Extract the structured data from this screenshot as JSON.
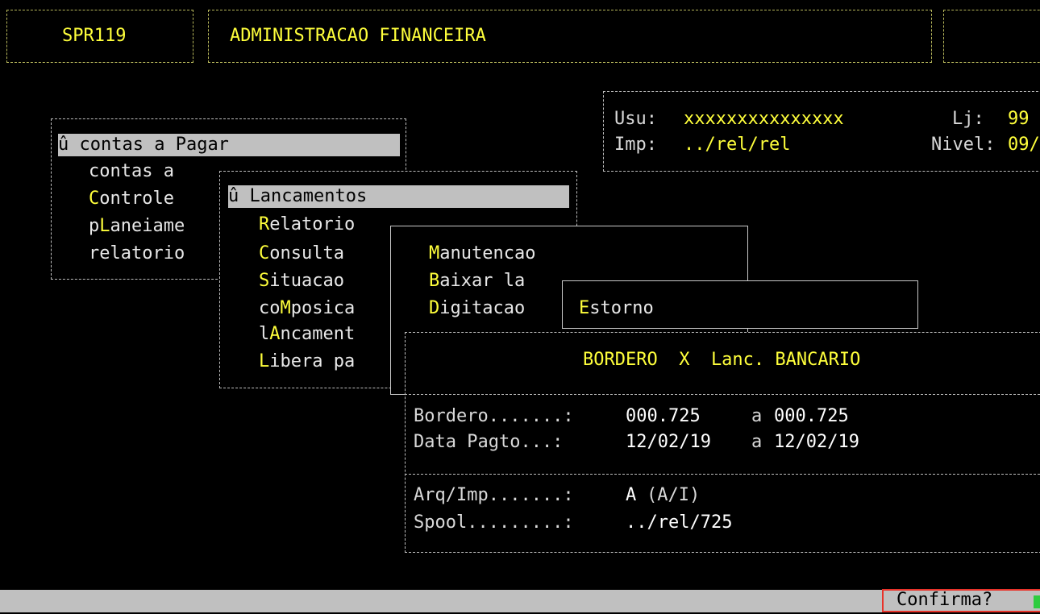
{
  "header": {
    "program_code": "SPR119",
    "module_title": "ADMINISTRACAO FINANCEIRA"
  },
  "user_info": {
    "usu_label": "Usu:",
    "usu_value": "xxxxxxxxxxxxxxx",
    "lj_label": "Lj:",
    "lj_value": "99",
    "imp_label": "Imp:",
    "imp_value": "../rel/rel",
    "nivel_label": "Nivel:",
    "nivel_value": "09/"
  },
  "menu1": {
    "marker": "û",
    "selected": "contas a Pagar",
    "items": [
      {
        "pre": "contas a",
        "key": "",
        "post": ""
      },
      {
        "pre": "",
        "key": "C",
        "post": "ontrole"
      },
      {
        "pre": "p",
        "key": "L",
        "post": "aneiame"
      },
      {
        "pre": "relatorio",
        "key": "",
        "post": ""
      }
    ]
  },
  "menu2": {
    "marker": "û",
    "selected": "Lancamentos",
    "items": [
      {
        "pre": "",
        "key": "R",
        "post": "elatorio"
      },
      {
        "pre": "",
        "key": "C",
        "post": "onsulta"
      },
      {
        "pre": "",
        "key": "S",
        "post": "ituacao"
      },
      {
        "pre": "co",
        "key": "M",
        "post": "posica"
      },
      {
        "pre": "l",
        "key": "A",
        "post": "ncament"
      },
      {
        "pre": "",
        "key": "L",
        "post": "ibera pa"
      }
    ]
  },
  "menu3": {
    "items": [
      {
        "pre": "",
        "key": "M",
        "post": "anutencao"
      },
      {
        "pre": "",
        "key": "B",
        "post": "aixar la"
      },
      {
        "pre": "",
        "key": "D",
        "post": "igitacao"
      }
    ]
  },
  "menu4": {
    "items": [
      {
        "pre": "",
        "key": "E",
        "post": "storno"
      }
    ]
  },
  "dialog": {
    "title": "BORDERO  X  Lanc. BANCARIO",
    "bordero_label": "Bordero.......:",
    "bordero_from": "000.725",
    "bordero_sep": "a",
    "bordero_to": "000.725",
    "data_label": "Data Pagto...:",
    "data_from": "12/02/19",
    "data_sep": "a",
    "data_to": "12/02/19",
    "arq_label": "Arq/Imp.......:",
    "arq_value": "A",
    "arq_hint": "(A/I)",
    "spool_label": "Spool.........:",
    "spool_value": "../rel/725"
  },
  "status": {
    "prompt": "Confirma?"
  }
}
